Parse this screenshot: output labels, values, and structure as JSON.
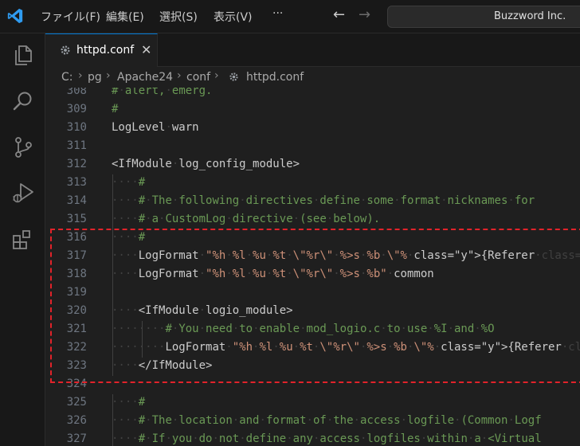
{
  "titlebar": {
    "menu": [
      "ファイル(F)",
      "編集(E)",
      "選択(S)",
      "表示(V)",
      "···"
    ],
    "back_arrow": "←",
    "forward_arrow": "→",
    "command_center": "Buzzword Inc."
  },
  "tab": {
    "label": "httpd.conf",
    "close": "✕"
  },
  "breadcrumb": {
    "items": [
      "C:",
      "pg",
      "Apache24",
      "conf",
      "httpd.conf"
    ],
    "separator": "›"
  },
  "colors": {
    "accent": "#0078d4",
    "highlight_box": "#e2232a",
    "comment": "#6a9955",
    "string": "#ce9178",
    "bracket": "#ffd700"
  },
  "lines": [
    {
      "n": "308",
      "text": "# alert, emerg."
    },
    {
      "n": "309",
      "text": "#"
    },
    {
      "n": "310",
      "text": "LogLevel warn"
    },
    {
      "n": "311",
      "text": ""
    },
    {
      "n": "312",
      "text": "<IfModule log_config_module>"
    },
    {
      "n": "313",
      "text": "#"
    },
    {
      "n": "314",
      "text": "# The following directives define some format nicknames for"
    },
    {
      "n": "315",
      "text": "# a CustomLog directive (see below)."
    },
    {
      "n": "316",
      "text": "#"
    },
    {
      "n": "317",
      "text": "LogFormat \"%h %l %u %t \\\"%r\\\" %>s %b \\\"%{Referer}i\\\" \\\"%{Use"
    },
    {
      "n": "318",
      "text": "LogFormat \"%h %l %u %t \\\"%r\\\" %>s %b\" common"
    },
    {
      "n": "319",
      "text": ""
    },
    {
      "n": "320",
      "text": "<IfModule logio_module>"
    },
    {
      "n": "321",
      "text": "# You need to enable mod_logio.c to use %I and %O"
    },
    {
      "n": "322",
      "text": "LogFormat \"%h %l %u %t \\\"%r\\\" %>s %b \\\"%{Referer}i\\\" \\\"%{U"
    },
    {
      "n": "323",
      "text": "</IfModule>"
    },
    {
      "n": "324",
      "text": ""
    },
    {
      "n": "325",
      "text": "#"
    },
    {
      "n": "326",
      "text": "# The location and format of the access logfile (Common Logf"
    },
    {
      "n": "327",
      "text": "# If you do not define any access logfiles within a <Virtual"
    }
  ]
}
